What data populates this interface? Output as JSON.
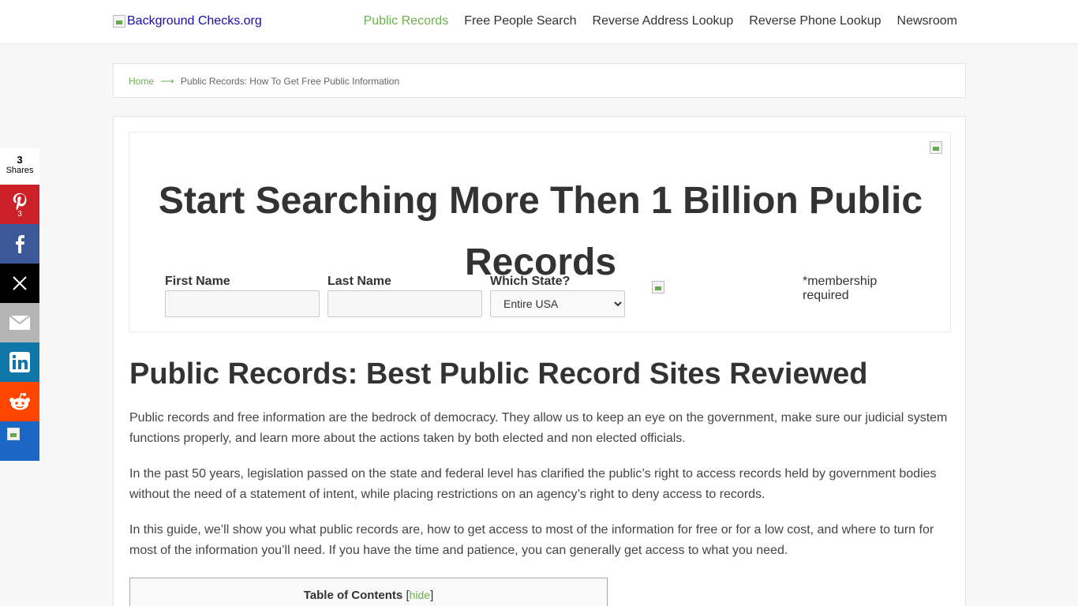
{
  "header": {
    "logo_text": "Background Checks.org",
    "nav": [
      {
        "label": "Public Records",
        "active": true
      },
      {
        "label": "Free People Search"
      },
      {
        "label": "Reverse Address Lookup"
      },
      {
        "label": "Reverse Phone Lookup"
      },
      {
        "label": "Newsroom"
      }
    ]
  },
  "breadcrumb": {
    "home": "Home",
    "separator": "⟶",
    "current": "Public Records: How To Get Free Public Information"
  },
  "search": {
    "title": "Start Searching More Then 1 Billion Public Records",
    "first_name_label": "First Name",
    "last_name_label": "Last Name",
    "state_label": "Which State?",
    "state_selected": "Entire USA",
    "membership_note": "*membership required"
  },
  "article": {
    "title": "Public Records: Best Public Record Sites Reviewed",
    "paragraphs": [
      "Public records and free information are the bedrock of democracy. They allow us to keep an eye on the government, make sure our judicial system functions properly, and learn more about the actions taken by both elected and non elected officials.",
      "In the past 50 years, legislation passed on the state and federal level has clarified the public’s right to access records held by government bodies without the need of a statement of intent, while placing restrictions on an agency’s right to deny access to records.",
      "In this guide, we’ll show you what public records are, how to get access to most of the information for free or for a low cost, and where to turn for most of the information you’ll need. If you have the time and patience, you can generally get access to what you need."
    ],
    "toc": {
      "title": "Table of Contents",
      "bracket_open": "[",
      "toggle": "hide",
      "bracket_close": "]"
    }
  },
  "share": {
    "count": "3",
    "count_label": "Shares",
    "pinterest_count": "3",
    "colors": {
      "pinterest": "#cb2027",
      "facebook": "#3b5998",
      "x": "#000000",
      "email": "#b5b5b5",
      "linkedin": "#0e76a8",
      "reddit": "#ff4500"
    }
  },
  "colors": {
    "accent": "#6ab04c",
    "text": "#333333"
  }
}
